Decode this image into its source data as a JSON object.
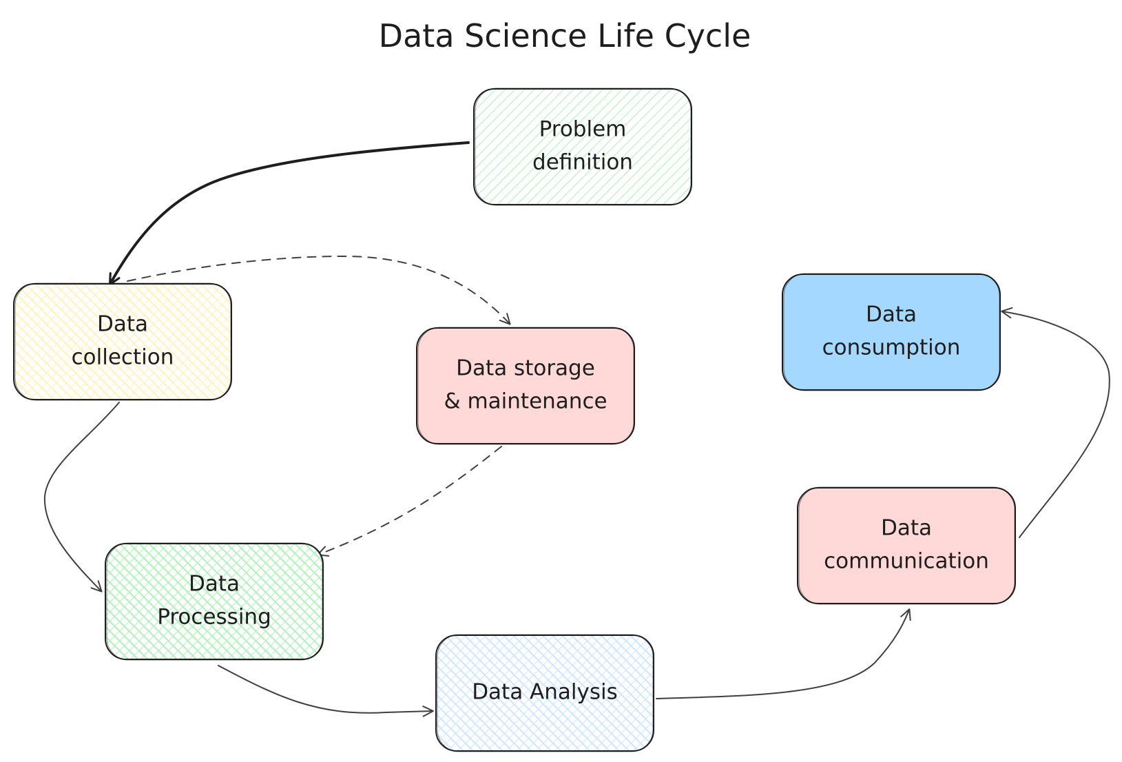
{
  "title": "Data Science Life Cycle",
  "colors": {
    "green": "#b2f2bb",
    "yellow": "#fff3bf",
    "red": "#ffd8d8",
    "blue": "#a5d8ff",
    "lightblue": "#cfe8ff",
    "stroke": "#1e1e1e"
  },
  "nodes": [
    {
      "id": "problem",
      "lines": [
        "Problem",
        "definition"
      ],
      "color": "green",
      "fill": "hachure"
    },
    {
      "id": "collection",
      "lines": [
        "Data",
        "collection"
      ],
      "color": "yellow",
      "fill": "cross-hatch"
    },
    {
      "id": "storage",
      "lines": [
        "Data storage",
        "& maintenance"
      ],
      "color": "red",
      "fill": "solid"
    },
    {
      "id": "processing",
      "lines": [
        "Data",
        "Processing"
      ],
      "color": "green",
      "fill": "cross-hatch"
    },
    {
      "id": "analysis",
      "lines": [
        "Data Analysis"
      ],
      "color": "lightblue",
      "fill": "cross-hatch"
    },
    {
      "id": "communication",
      "lines": [
        "Data",
        "communication"
      ],
      "color": "red",
      "fill": "solid"
    },
    {
      "id": "consumption",
      "lines": [
        "Data",
        "consumption"
      ],
      "color": "blue",
      "fill": "solid"
    }
  ],
  "edges": [
    {
      "from": "problem",
      "to": "collection",
      "style": "bold"
    },
    {
      "from": "collection",
      "to": "storage",
      "style": "dashed"
    },
    {
      "from": "collection",
      "to": "processing",
      "style": "solid"
    },
    {
      "from": "storage",
      "to": "processing",
      "style": "dashed"
    },
    {
      "from": "processing",
      "to": "analysis",
      "style": "solid"
    },
    {
      "from": "analysis",
      "to": "communication",
      "style": "solid"
    },
    {
      "from": "communication",
      "to": "consumption",
      "style": "solid"
    }
  ]
}
